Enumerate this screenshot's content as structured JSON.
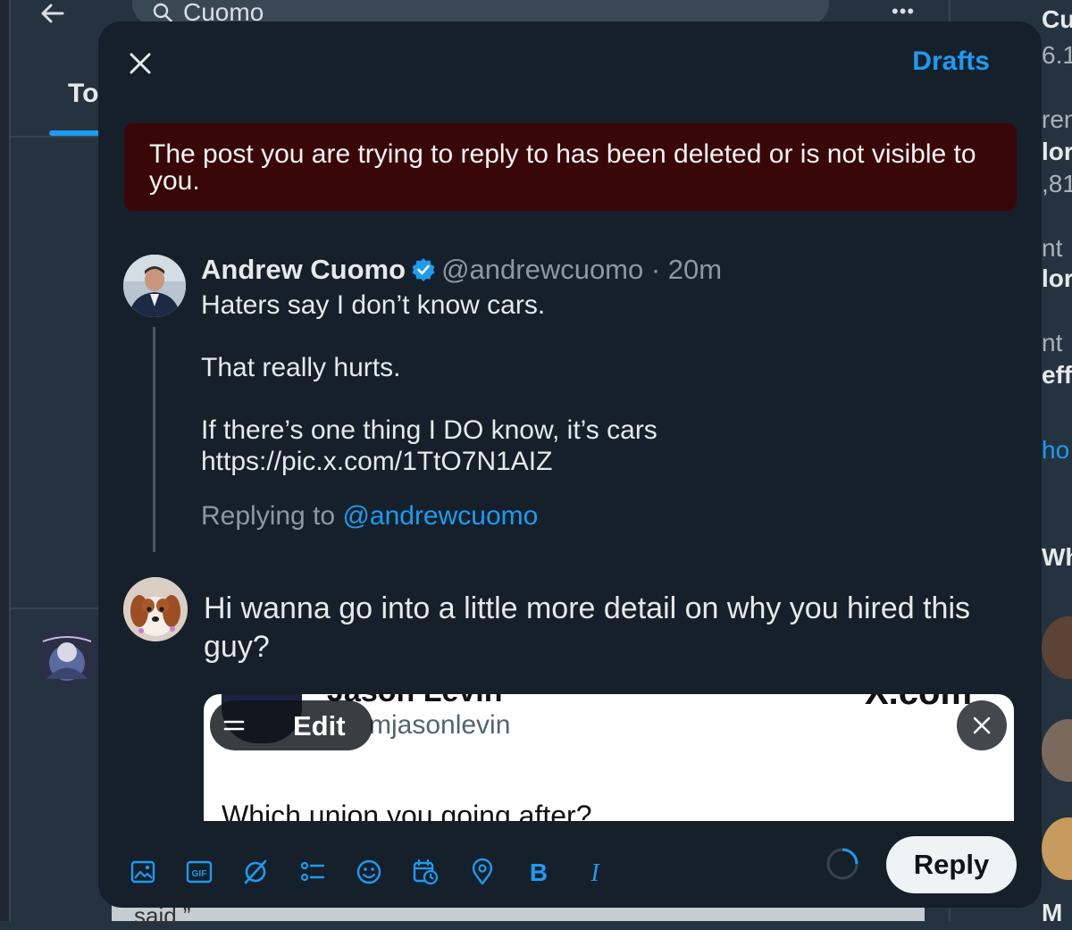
{
  "background": {
    "search_value": "Cuomo",
    "tab_partial": "To",
    "bottom_text_partial": "said.”",
    "right_column_fragments": [
      "Cuo",
      "6.1",
      "ren",
      "lor",
      ",81",
      "nt",
      "lor",
      "nt",
      "eff",
      "ho",
      "Wh",
      "M"
    ]
  },
  "modal": {
    "drafts_label": "Drafts",
    "alert_text": "The post you are trying to reply to has been deleted or is not visible to you.",
    "original_post": {
      "author_name": "Andrew Cuomo",
      "handle_time": "@andrewcuomo · 20m",
      "lines": [
        "Haters say I don’t know cars.",
        "That really hurts.",
        "If there’s one thing I DO know, it’s cars",
        "https://pic.x.com/1TtO7N1AIZ"
      ],
      "replying_prefix": "Replying to ",
      "replying_mention": "@andrewcuomo"
    },
    "compose": {
      "text": "Hi wanna go into a little more detail on why you hired this guy?",
      "media": {
        "top_name_partial": "Jason Levin",
        "site_label": "X.com",
        "handle_partial": "mjasonlevin",
        "question_partial": "Which union you going after?",
        "edit_label": "Edit"
      }
    },
    "toolbar": {
      "icons": [
        "image-icon",
        "gif-icon",
        "grok-icon",
        "poll-icon",
        "emoji-icon",
        "schedule-icon",
        "location-icon",
        "bold-icon",
        "italic-icon"
      ],
      "gif_text": "GIF",
      "bold_text": "B",
      "italic_text": "I"
    },
    "reply_label": "Reply"
  },
  "colors": {
    "accent": "#1d9bf0",
    "modal_bg": "#15202b",
    "alert_bg": "#3a0708",
    "page_bg": "#253341"
  }
}
